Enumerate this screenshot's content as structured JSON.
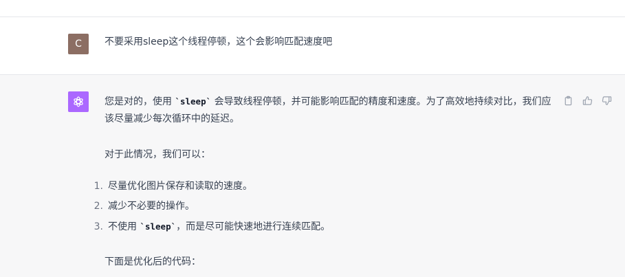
{
  "user": {
    "avatar_letter": "C",
    "message": "不要采用sleep这个线程停顿，这个会影响匹配速度吧"
  },
  "assistant": {
    "avatar_icon": "openai-logo-icon",
    "p1_before": "您是对的，使用 ",
    "p1_code": "`sleep`",
    "p1_after": " 会导致线程停顿，并可能影响匹配的精度和速度。为了高效地持续对比，我们应该尽量减少每次循环中的延迟。",
    "p2": "对于此情况，我们可以：",
    "list": [
      {
        "num": "1.",
        "text": "尽量优化图片保存和读取的速度。"
      },
      {
        "num": "2.",
        "text": "减少不必要的操作。"
      },
      {
        "num": "3.",
        "text_before": "不使用 ",
        "code": "`sleep`",
        "text_after": "，而是尽可能快速地进行连续匹配。"
      }
    ],
    "p3": "下面是优化后的代码：",
    "actions": [
      "copy-icon",
      "thumbs-up-icon",
      "thumbs-down-icon"
    ]
  },
  "colors": {
    "user_avatar_bg": "#8c6e63",
    "gpt_avatar_bg": "#ab68ff",
    "assistant_bg": "#f7f7f8",
    "text": "#374151"
  }
}
